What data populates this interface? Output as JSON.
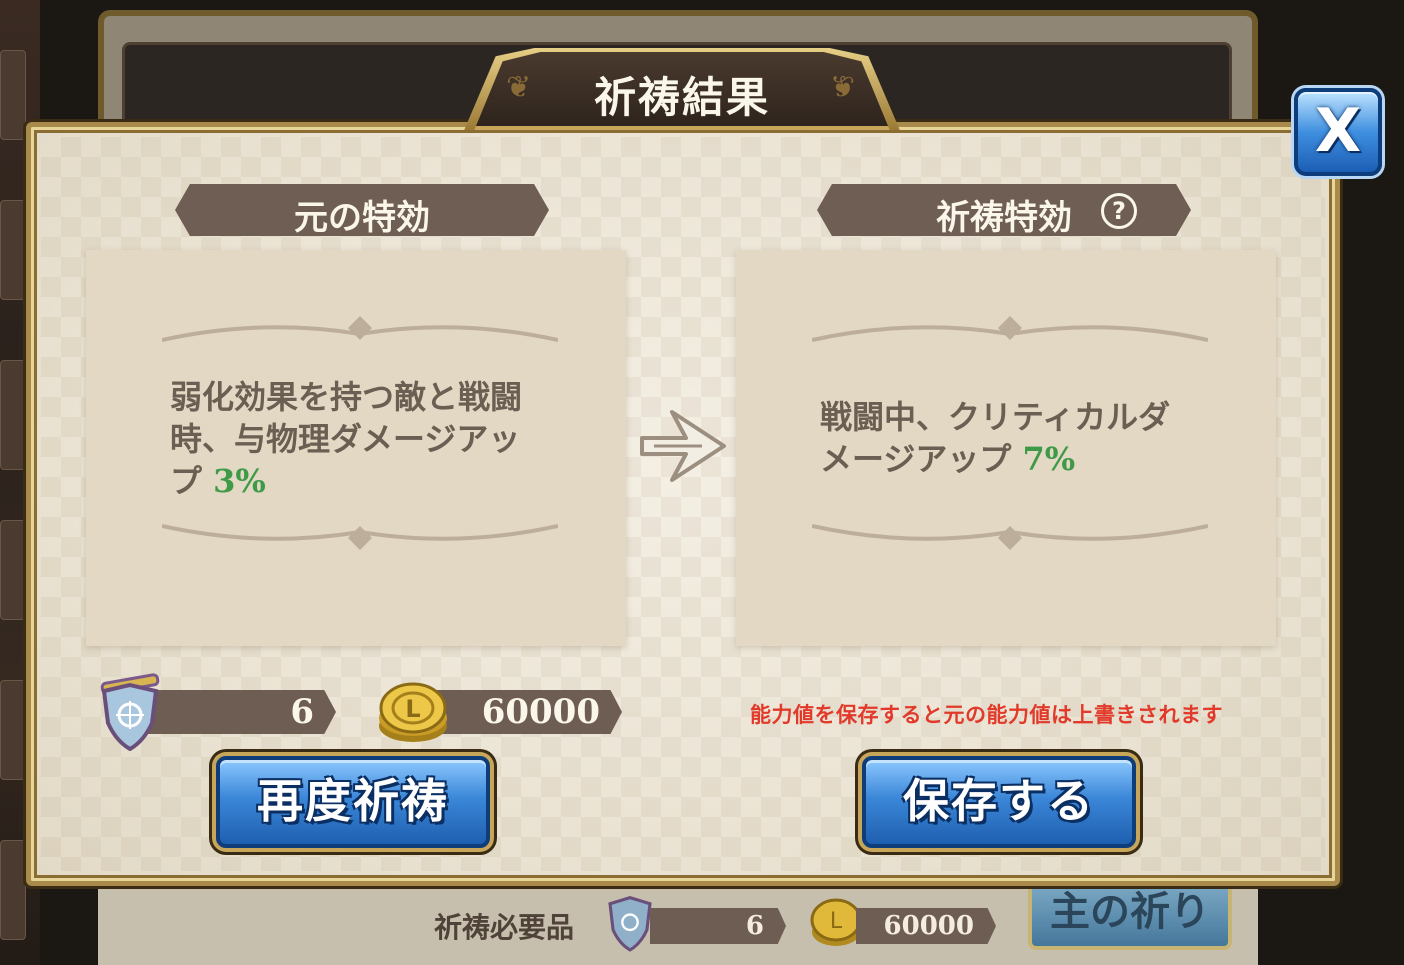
{
  "background": {
    "required_items_label": "祈祷必要品",
    "required_item_count": "6",
    "required_gold": "60000",
    "partial_button_label": "主の祈り"
  },
  "dialog": {
    "title": "祈祷結果",
    "close_label": "X",
    "original": {
      "header": "元の特効",
      "effect_text": "弱化効果を持つ敵と戦闘時、与物理ダメージアップ",
      "effect_value": "3%"
    },
    "prayer": {
      "header": "祈祷特効",
      "help_icon": "?",
      "effect_text": "戦闘中、クリティカルダメージアップ",
      "effect_value": "7%"
    },
    "cost": {
      "item_count": "6",
      "gold": "60000"
    },
    "warning": "能力値を保存すると元の能力値は上書きされます",
    "buttons": {
      "retry": "再度祈祷",
      "save": "保存する"
    }
  },
  "colors": {
    "accent_green": "#3f9a47",
    "warning_red": "#e23a2a",
    "button_blue": "#3b87d8",
    "ribbon_brown": "#6f5e53"
  },
  "icons": {
    "item": "prayer-shield-icon",
    "currency": "gold-coin-icon",
    "arrow": "arrow-right-icon",
    "help": "help-icon",
    "close": "close-icon"
  }
}
